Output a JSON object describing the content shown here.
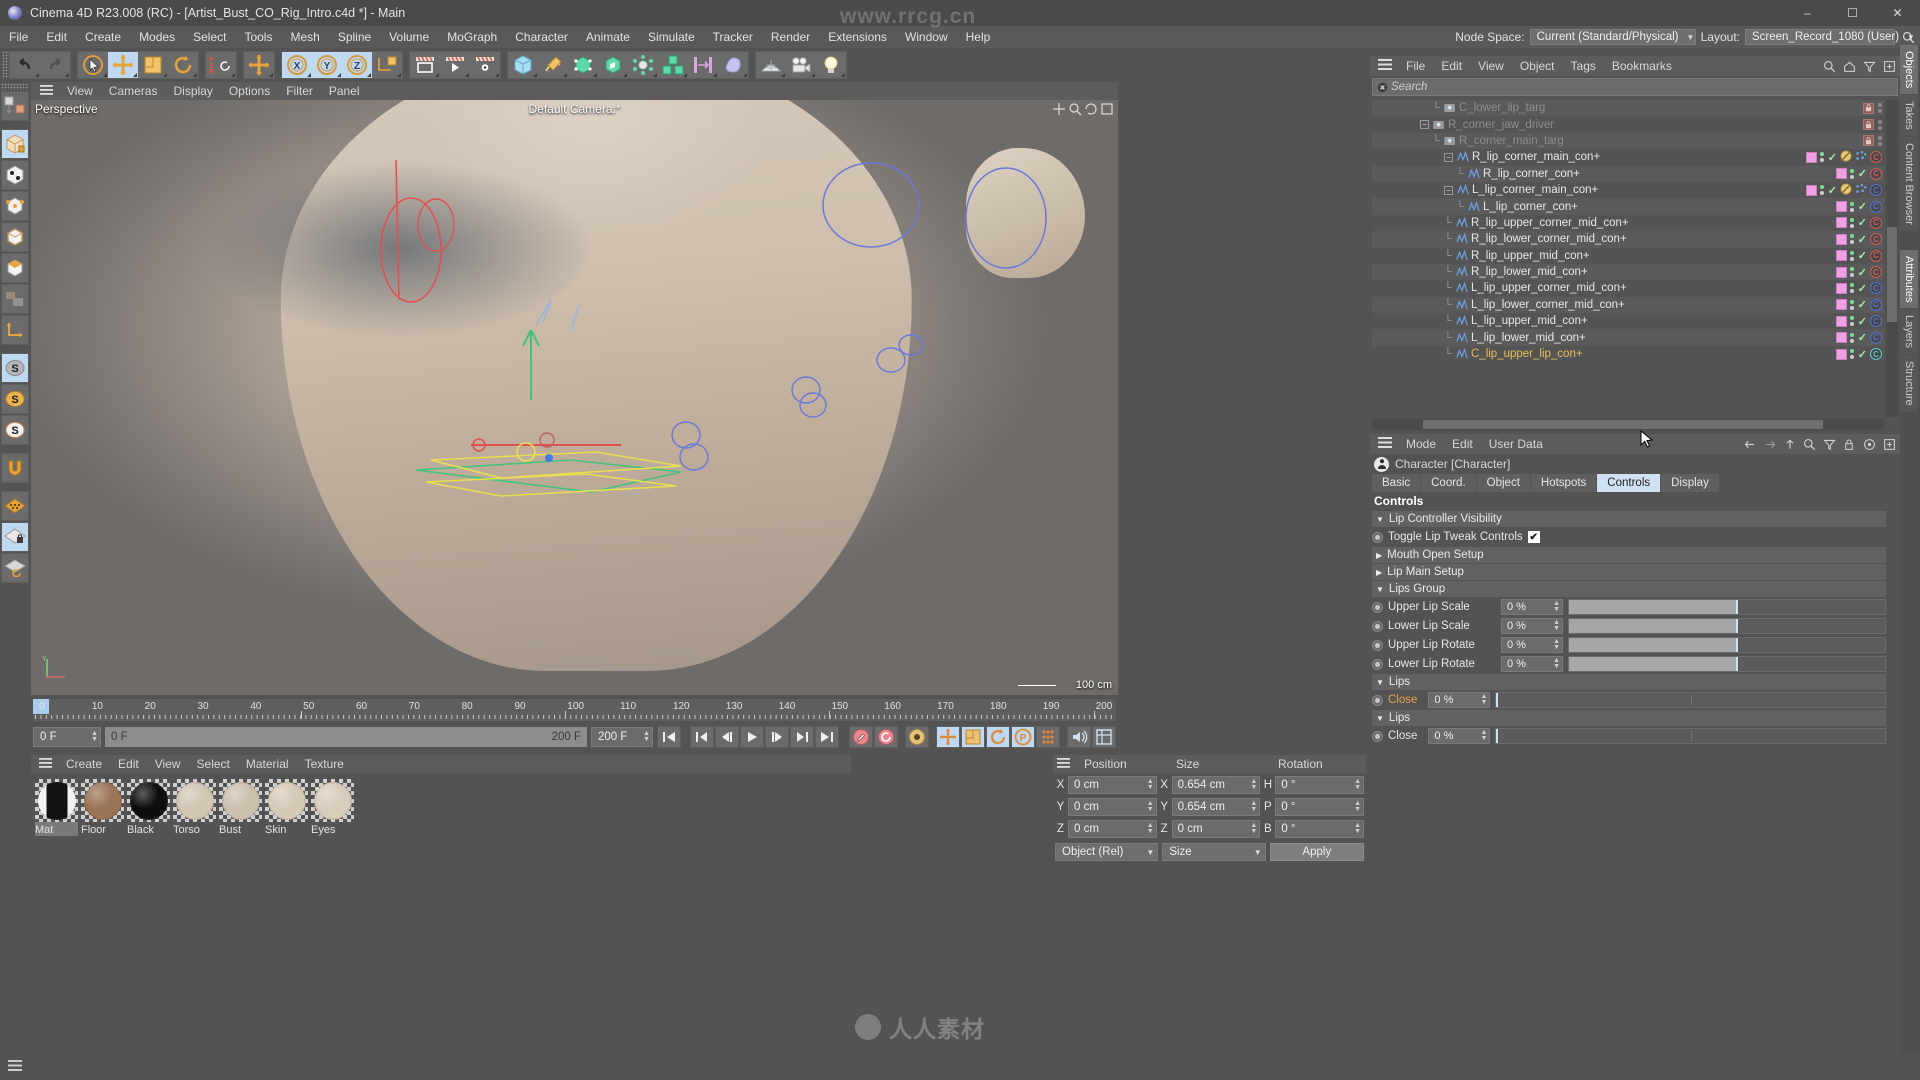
{
  "window": {
    "title": "Cinema 4D R23.008 (RC) - [Artist_Bust_CO_Rig_Intro.c4d *] - Main",
    "minimize": "–",
    "maximize": "☐",
    "close": "✕"
  },
  "watermarks": {
    "top1": "www.rrcg.cn",
    "bottom": "人人素材"
  },
  "menubar": {
    "items": [
      "File",
      "Edit",
      "Create",
      "Modes",
      "Select",
      "Tools",
      "Mesh",
      "Spline",
      "Volume",
      "MoGraph",
      "Character",
      "Animate",
      "Simulate",
      "Tracker",
      "Render",
      "Extensions",
      "Window",
      "Help"
    ],
    "node_space_label": "Node Space:",
    "node_space_value": "Current (Standard/Physical)",
    "layout_label": "Layout:",
    "layout_value": "Screen_Record_1080 (User)",
    "search_icon": "search-icon"
  },
  "toolbar": {
    "groups": [
      {
        "name": "undo-redo",
        "buttons": [
          {
            "name": "undo-button",
            "icon": "undo-icon",
            "active": false
          },
          {
            "name": "redo-button",
            "icon": "redo-icon",
            "active": false
          }
        ]
      },
      {
        "name": "transform-tools",
        "buttons": [
          {
            "name": "live-selection-tool",
            "icon": "cursor-circle-icon",
            "active": false
          },
          {
            "name": "move-tool",
            "icon": "move-arrows-icon",
            "active": true
          },
          {
            "name": "scale-tool",
            "icon": "scale-box-icon",
            "active": false
          },
          {
            "name": "rotate-tool",
            "icon": "rotate-arc-icon",
            "active": false
          }
        ]
      },
      {
        "name": "psr-group",
        "buttons": [
          {
            "name": "psr-reset-button",
            "icon": "psr-icon",
            "active": false
          }
        ]
      },
      {
        "name": "world-object-group",
        "buttons": [
          {
            "name": "world-object-axis-button",
            "icon": "move-arrows-icon",
            "active": false
          }
        ]
      },
      {
        "name": "axis-locks",
        "buttons": [
          {
            "name": "x-axis-lock",
            "icon": "x-axis-icon",
            "active": true
          },
          {
            "name": "y-axis-lock",
            "icon": "y-axis-icon",
            "active": true
          },
          {
            "name": "z-axis-lock",
            "icon": "z-axis-icon",
            "active": true
          },
          {
            "name": "world-coordinate-toggle",
            "icon": "world-axis-cube-icon",
            "active": false
          }
        ]
      },
      {
        "name": "render-group",
        "buttons": [
          {
            "name": "render-view-button",
            "icon": "render-view-icon",
            "active": false
          },
          {
            "name": "render-to-picture-viewer-button",
            "icon": "render-picture-icon",
            "active": false
          },
          {
            "name": "render-settings-button",
            "icon": "render-settings-icon",
            "active": false
          }
        ]
      },
      {
        "name": "primitives-group",
        "buttons": [
          {
            "name": "cube-button",
            "icon": "cube-icon",
            "active": false
          },
          {
            "name": "spline-pen-button",
            "icon": "pen-spline-icon",
            "active": false
          },
          {
            "name": "nurbs-button",
            "icon": "nurbs-icon",
            "active": false
          },
          {
            "name": "array-button",
            "icon": "array-icon",
            "active": false
          },
          {
            "name": "scene-nodes-button",
            "icon": "scene-nodes-icon",
            "active": false
          },
          {
            "name": "mograph-button",
            "icon": "mograph-cubes-icon",
            "active": false
          },
          {
            "name": "deformer-button",
            "icon": "bend-deformer-icon",
            "active": false
          },
          {
            "name": "field-button",
            "icon": "field-icon",
            "active": false
          }
        ]
      },
      {
        "name": "scene-group",
        "buttons": [
          {
            "name": "floor-button",
            "icon": "floor-grid-icon",
            "active": false
          },
          {
            "name": "camera-button",
            "icon": "camera-icon",
            "active": false
          },
          {
            "name": "light-button",
            "icon": "light-bulb-icon",
            "active": false
          }
        ]
      }
    ]
  },
  "left_toolbar": [
    {
      "name": "make-editable-button",
      "icon": "make-editable-icon",
      "active": false
    },
    {
      "name": "model-mode-button",
      "icon": "model-mode-icon",
      "active": true
    },
    {
      "name": "texture-mode-button",
      "icon": "texture-mode-icon",
      "active": false
    },
    {
      "name": "points-mode-button",
      "icon": "points-mode-icon",
      "active": false
    },
    {
      "name": "edges-mode-button",
      "icon": "edges-mode-icon",
      "active": false
    },
    {
      "name": "polygons-mode-button",
      "icon": "polygons-mode-icon",
      "active": false
    },
    {
      "name": "uv-mode-button",
      "icon": "uv-mode-icon",
      "active": false
    },
    {
      "name": "axis-mode-button",
      "icon": "axis-mode-icon",
      "active": false
    },
    {
      "name": "enable-axis-button",
      "icon": "s-grey-icon",
      "active": true
    },
    {
      "name": "viewport-solo-button",
      "icon": "s-orange-icon",
      "active": false
    },
    {
      "name": "viewport-solo-off-button",
      "icon": "s-white-icon",
      "active": false
    },
    {
      "name": "snap-button",
      "icon": "magnet-icon",
      "active": false
    },
    {
      "name": "workplane-button",
      "icon": "workplane-icon",
      "active": false
    },
    {
      "name": "lock-workplane-button",
      "icon": "workplane-lock-icon",
      "active": true
    },
    {
      "name": "planar-workplane-button",
      "icon": "workplane-rotate-icon",
      "active": false
    }
  ],
  "viewport": {
    "menu": [
      "View",
      "Cameras",
      "Display",
      "Options",
      "Filter",
      "Panel"
    ],
    "label": "Perspective",
    "camera": "Default Camera:*",
    "scale": "100 cm",
    "nav_icons": [
      "viewport-pan-icon",
      "viewport-zoom-icon",
      "viewport-rotate-icon",
      "viewport-maximize-icon"
    ]
  },
  "timeline": {
    "ticks": [
      "0",
      "10",
      "20",
      "30",
      "40",
      "50",
      "60",
      "70",
      "80",
      "90",
      "100",
      "110",
      "120",
      "130",
      "140",
      "150",
      "160",
      "170",
      "180",
      "190",
      "200"
    ],
    "current_frame": "0 F",
    "preview_start": "0 F",
    "preview_end": "200 F",
    "doc_end": "200 F",
    "right_frame_field": "0 F",
    "transport": [
      {
        "name": "go-to-start-button",
        "icon": "skip-start-icon"
      },
      {
        "name": "previous-keyframe-button",
        "icon": "prev-key-icon"
      },
      {
        "name": "previous-frame-button",
        "icon": "step-back-icon"
      },
      {
        "name": "play-button",
        "icon": "play-icon"
      },
      {
        "name": "next-frame-button",
        "icon": "step-forward-icon"
      },
      {
        "name": "next-keyframe-button",
        "icon": "next-key-icon"
      },
      {
        "name": "go-to-end-button",
        "icon": "skip-end-icon"
      }
    ],
    "record_tools": [
      {
        "name": "record-active-objects-button",
        "icon": "record-key-icon",
        "active": false
      },
      {
        "name": "autokeying-button",
        "icon": "autokey-icon",
        "active": false
      },
      {
        "name": "keyframe-selection-button",
        "icon": "keyframe-selection-icon",
        "active": false
      },
      {
        "name": "position-key-button",
        "icon": "position-key-icon",
        "active": true
      },
      {
        "name": "scale-key-button",
        "icon": "scale-key-icon",
        "active": true
      },
      {
        "name": "rotation-key-button",
        "icon": "rotation-key-icon",
        "active": true
      },
      {
        "name": "parameter-key-button",
        "icon": "parameter-key-icon",
        "active": true
      },
      {
        "name": "point-level-animation-button",
        "icon": "pla-icon",
        "active": false
      },
      {
        "name": "sound-button",
        "icon": "sound-icon",
        "active": false
      },
      {
        "name": "layout-button",
        "icon": "timeline-layout-icon",
        "active": false
      }
    ]
  },
  "material_manager": {
    "menu": [
      "Create",
      "Edit",
      "View",
      "Select",
      "Material",
      "Texture"
    ],
    "materials": [
      {
        "name": "Mat",
        "color": "#121212",
        "selected": true
      },
      {
        "name": "Floor",
        "color": "#9b7456",
        "selected": false
      },
      {
        "name": "Black",
        "color": "#0d0d0d",
        "selected": false
      },
      {
        "name": "Torso",
        "color": "#d3c7b4",
        "selected": false
      },
      {
        "name": "Bust",
        "color": "#cdc0ae",
        "selected": false
      },
      {
        "name": "Skin",
        "color": "#d6cab7",
        "selected": false
      },
      {
        "name": "Eyes",
        "color": "#d8ccbb",
        "selected": false
      }
    ]
  },
  "coordinate_manager": {
    "headers": [
      "Position",
      "Size",
      "Rotation"
    ],
    "rows": [
      {
        "p_label": "X",
        "p_value": "0 cm",
        "s_label": "X",
        "s_value": "0.654 cm",
        "r_label": "H",
        "r_value": "0 °"
      },
      {
        "p_label": "Y",
        "p_value": "0 cm",
        "s_label": "Y",
        "s_value": "0.654 cm",
        "r_label": "P",
        "r_value": "0 °"
      },
      {
        "p_label": "Z",
        "p_value": "0 cm",
        "s_label": "Z",
        "s_value": "0 cm",
        "r_label": "B",
        "r_value": "0 °"
      }
    ],
    "mode_value": "Object (Rel)",
    "size_value": "Size",
    "apply_label": "Apply"
  },
  "object_manager": {
    "menu": [
      "File",
      "Edit",
      "View",
      "Object",
      "Tags",
      "Bookmarks"
    ],
    "icons": [
      "search-icon",
      "home-icon",
      "filter-icon",
      "add-panel-icon"
    ],
    "search_placeholder": "Search",
    "clear_icon": "clear-icon",
    "rows": [
      {
        "name": "C_lower_lip_targ",
        "depth": 5,
        "expander": "none",
        "elbow": true,
        "icon": "null-object-icon",
        "dim": true,
        "locked": true,
        "tags": []
      },
      {
        "name": "R_corner_jaw_driver",
        "depth": 4,
        "expander": "minus",
        "elbow": false,
        "icon": "null-object-icon",
        "dim": true,
        "locked": true,
        "tags": []
      },
      {
        "name": "R_corner_main_targ",
        "depth": 5,
        "expander": "none",
        "elbow": true,
        "icon": "null-object-icon",
        "dim": true,
        "locked": true,
        "tags": []
      },
      {
        "name": "R_lip_corner_main_con+",
        "depth": 6,
        "expander": "minus",
        "elbow": false,
        "icon": "spline-icon",
        "dim": false,
        "locked": false,
        "tags": [
          "pink",
          "dots",
          "check",
          "disabled",
          "constraint-dots",
          "c-red"
        ]
      },
      {
        "name": "R_lip_corner_con+",
        "depth": 7,
        "expander": "none",
        "elbow": true,
        "icon": "spline-icon",
        "dim": false,
        "locked": false,
        "tags": [
          "pink",
          "dots",
          "check",
          "c-red"
        ]
      },
      {
        "name": "L_lip_corner_main_con+",
        "depth": 6,
        "expander": "minus",
        "elbow": false,
        "icon": "spline-icon",
        "dim": false,
        "locked": false,
        "tags": [
          "pink",
          "dots",
          "check",
          "disabled",
          "constraint-dots",
          "c-blue"
        ]
      },
      {
        "name": "L_lip_corner_con+",
        "depth": 7,
        "expander": "none",
        "elbow": true,
        "icon": "spline-icon",
        "dim": false,
        "locked": false,
        "tags": [
          "pink",
          "dots",
          "check",
          "c-blue"
        ]
      },
      {
        "name": "R_lip_upper_corner_mid_con+",
        "depth": 6,
        "expander": "none",
        "elbow": true,
        "icon": "spline-icon",
        "dim": false,
        "locked": false,
        "tags": [
          "pink",
          "dots",
          "check",
          "c-red"
        ]
      },
      {
        "name": "R_lip_lower_corner_mid_con+",
        "depth": 6,
        "expander": "none",
        "elbow": true,
        "icon": "spline-icon",
        "dim": false,
        "locked": false,
        "tags": [
          "pink",
          "dots",
          "check",
          "c-red"
        ]
      },
      {
        "name": "R_lip_upper_mid_con+",
        "depth": 6,
        "expander": "none",
        "elbow": true,
        "icon": "spline-icon",
        "dim": false,
        "locked": false,
        "tags": [
          "pink",
          "dots",
          "check",
          "c-red"
        ]
      },
      {
        "name": "R_lip_lower_mid_con+",
        "depth": 6,
        "expander": "none",
        "elbow": true,
        "icon": "spline-icon",
        "dim": false,
        "locked": false,
        "tags": [
          "pink",
          "dots",
          "check",
          "c-red"
        ]
      },
      {
        "name": "L_lip_upper_corner_mid_con+",
        "depth": 6,
        "expander": "none",
        "elbow": true,
        "icon": "spline-icon",
        "dim": false,
        "locked": false,
        "tags": [
          "pink",
          "dots",
          "check",
          "c-blue"
        ]
      },
      {
        "name": "L_lip_lower_corner_mid_con+",
        "depth": 6,
        "expander": "none",
        "elbow": true,
        "icon": "spline-icon",
        "dim": false,
        "locked": false,
        "tags": [
          "pink",
          "dots",
          "check",
          "c-blue"
        ]
      },
      {
        "name": "L_lip_upper_mid_con+",
        "depth": 6,
        "expander": "none",
        "elbow": true,
        "icon": "spline-icon",
        "dim": false,
        "locked": false,
        "tags": [
          "pink",
          "dots",
          "check",
          "c-blue"
        ]
      },
      {
        "name": "L_lip_lower_mid_con+",
        "depth": 6,
        "expander": "none",
        "elbow": true,
        "icon": "spline-icon",
        "dim": false,
        "locked": false,
        "tags": [
          "pink",
          "dots",
          "check",
          "c-blue"
        ]
      },
      {
        "name": "C_lip_upper_lip_con+",
        "depth": 6,
        "expander": "none",
        "elbow": true,
        "icon": "spline-icon",
        "dim": false,
        "selected": true,
        "locked": false,
        "tags": [
          "pink",
          "dots",
          "check",
          "c-cyan"
        ]
      }
    ]
  },
  "attribute_manager": {
    "menu": [
      "Mode",
      "Edit",
      "User Data"
    ],
    "icons": [
      "back-arrow-icon",
      "forward-arrow-icon",
      "up-arrow-icon",
      "search-icon",
      "filter-icon",
      "lock-icon",
      "target-icon",
      "add-panel-icon"
    ],
    "object_title": "Character [Character]",
    "object_icon": "character-icon",
    "tabs": [
      {
        "label": "Basic",
        "active": false
      },
      {
        "label": "Coord.",
        "active": false
      },
      {
        "label": "Object",
        "active": false
      },
      {
        "label": "Hotspots",
        "active": false
      },
      {
        "label": "Controls",
        "active": true
      },
      {
        "label": "Display",
        "active": false
      }
    ],
    "section_title": "Controls",
    "groups": [
      {
        "type": "group",
        "label": "Lip Controller Visibility",
        "open": true
      },
      {
        "type": "checkbox",
        "label": "Toggle Lip Tweak Controls",
        "checked": true
      },
      {
        "type": "group",
        "label": "Mouth Open Setup",
        "open": false
      },
      {
        "type": "group",
        "label": "Lip Main Setup",
        "open": false
      },
      {
        "type": "group",
        "label": "Lips Group",
        "open": true
      },
      {
        "type": "slider",
        "label": "Upper Lip Scale",
        "value": "0 %",
        "fill": 53,
        "handle": 53
      },
      {
        "type": "slider",
        "label": "Lower Lip Scale",
        "value": "0 %",
        "fill": 53,
        "handle": 53
      },
      {
        "type": "slider",
        "label": "Upper Lip Rotate",
        "value": "0 %",
        "fill": 53,
        "handle": 53
      },
      {
        "type": "slider",
        "label": "Lower Lip Rotate",
        "value": "0 %",
        "fill": 53,
        "handle": 53
      },
      {
        "type": "group",
        "label": "Lips",
        "open": true
      },
      {
        "type": "slider-wide",
        "label": "Close",
        "label_color": "orange",
        "value": "0 %",
        "fill": 0,
        "handle": 0
      },
      {
        "type": "group",
        "label": "Lips",
        "open": true
      },
      {
        "type": "slider-wide",
        "label": "Close",
        "label_color": "normal",
        "value": "0 %",
        "fill": 0,
        "handle": 0
      }
    ]
  },
  "vertical_tabs_top": [
    {
      "label": "Objects",
      "active": true
    },
    {
      "label": "Takes",
      "active": false
    },
    {
      "label": "Content Browser",
      "active": false
    }
  ],
  "vertical_tabs_bottom": [
    {
      "label": "Attributes",
      "active": true
    },
    {
      "label": "Layers",
      "active": false
    },
    {
      "label": "Structure",
      "active": false
    }
  ],
  "colors": {
    "accent_blue": "#bfd9f2",
    "tag_pink": "#f2a0e6",
    "constraint_red": "#d45a5a",
    "constraint_blue": "#5a6fd4",
    "constraint_cyan": "#5ad4d4",
    "selected_text": "#e8c05a",
    "orange_label": "#e8a257"
  }
}
